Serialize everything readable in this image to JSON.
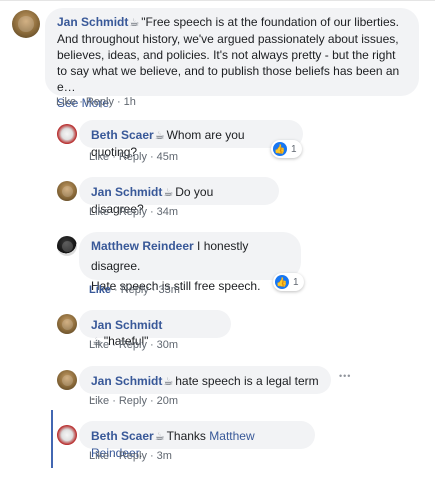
{
  "comments": [
    {
      "author": "Jan Schmidt",
      "text": "\"Free speech is at the foundation of our liberties. And throughout history, we've argued passionately about issues, believes, ideas, and policies. It's not always pretty - but the right to say what we believe, and to publish those beliefs has been an e…",
      "see_more": "See More",
      "actions": {
        "like": "Like",
        "reply": "Reply",
        "time": "1h"
      }
    },
    {
      "author": "Beth Scaer",
      "text": "Whom are you quoting?",
      "actions": {
        "like": "Like",
        "reply": "Reply",
        "time": "45m"
      },
      "reaction_count": "1"
    },
    {
      "author": "Jan Schmidt",
      "text": "Do you disagree?",
      "actions": {
        "like": "Like",
        "reply": "Reply",
        "time": "34m"
      }
    },
    {
      "author": "Matthew Reindeer",
      "text": "I honestly disagree.",
      "text2": "Hate speech is still free speech.",
      "actions": {
        "like": "Like",
        "reply": "Reply",
        "time": "33m"
      },
      "reaction_count": "1"
    },
    {
      "author": "Jan Schmidt",
      "text": "\"hateful\"",
      "actions": {
        "like": "Like",
        "reply": "Reply",
        "time": "30m"
      }
    },
    {
      "author": "Jan Schmidt",
      "text": "hate speech is a legal term -",
      "actions": {
        "like": "Like",
        "reply": "Reply",
        "time": "20m"
      },
      "more": "•••"
    },
    {
      "author": "Beth Scaer",
      "text_prefix": "Thanks",
      "mention": "Matthew Reindeer",
      "text_suffix": ".",
      "actions": {
        "like": "Like",
        "reply": "Reply",
        "time": "3m"
      }
    }
  ],
  "separator": "·",
  "cup_icon": "☕",
  "like_icon": "👍",
  "colors": {
    "link": "#385898",
    "bubble": "#f2f3f5",
    "thread_line": "#4267b2",
    "like_blue": "#1877f2"
  }
}
